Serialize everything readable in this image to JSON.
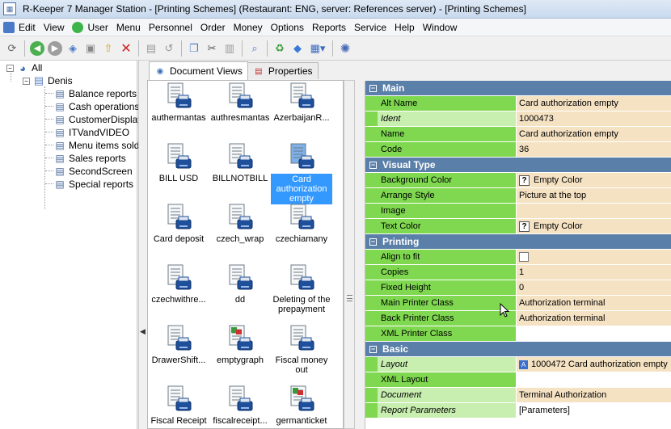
{
  "window": {
    "title": "R-Keeper 7 Manager Station - [Printing Schemes] (Restaurant: ENG, server: References server) - [Printing Schemes]"
  },
  "menu": [
    "Edit",
    "View",
    "User",
    "Menu",
    "Personnel",
    "Order",
    "Money",
    "Options",
    "Reports",
    "Service",
    "Help",
    "Window"
  ],
  "tree": {
    "root": "All",
    "child": "Denis",
    "items": [
      "Balance reports",
      "Cash operations",
      "CustomerDisplay",
      "ITVandVIDEO",
      "Menu items sold",
      "Sales reports",
      "SecondScreen",
      "Special reports"
    ]
  },
  "tabs": [
    "Document Views",
    "Properties"
  ],
  "documents": [
    "authermantas",
    "authresmantas",
    "AzerbaijanR...",
    "BILL USD",
    "BILLNOTBILL",
    "Card authorization empty",
    "Card deposit",
    "czech_wrap",
    "czechiamany",
    "czechwithre...",
    "dd",
    "Deleting of the prepayment",
    "DrawerShift...",
    "emptygraph",
    "Fiscal money out",
    "Fiscal Receipt",
    "fiscalreceipt...",
    "germanticket"
  ],
  "selected_document": "Card authorization empty",
  "properties": {
    "main": {
      "title": "Main",
      "rows": [
        {
          "name": "Alt Name",
          "value": "Card authorization empty"
        },
        {
          "name": "Ident",
          "value": "1000473"
        },
        {
          "name": "Name",
          "value": "Card authorization empty"
        },
        {
          "name": "Code",
          "value": "36"
        }
      ]
    },
    "visual": {
      "title": "Visual Type",
      "rows": [
        {
          "name": "Background Color",
          "value": "Empty Color"
        },
        {
          "name": "Arrange Style",
          "value": "Picture at the top"
        },
        {
          "name": "Image",
          "value": ""
        },
        {
          "name": "Text Color",
          "value": "Empty Color"
        }
      ]
    },
    "printing": {
      "title": "Printing",
      "rows": [
        {
          "name": "Align to fit",
          "value": ""
        },
        {
          "name": "Copies",
          "value": "1"
        },
        {
          "name": "Fixed Height",
          "value": "0"
        },
        {
          "name": "Main Printer Class",
          "value": "Authorization terminal"
        },
        {
          "name": "Back Printer Class",
          "value": "Authorization terminal"
        },
        {
          "name": "XML Printer Class",
          "value": ""
        }
      ]
    },
    "basic": {
      "title": "Basic",
      "rows": [
        {
          "name": "Layout",
          "value": "1000472 Card authorization empty"
        },
        {
          "name": "XML Layout",
          "value": ""
        },
        {
          "name": "Document",
          "value": "Terminal Authorization"
        },
        {
          "name": "Report Parameters",
          "value": "[Parameters]"
        }
      ]
    },
    "glyph_help": "?",
    "glyph_layout": "A"
  },
  "colors": {
    "category": "#5a7fa8",
    "name_cell": "#7fd850",
    "name_cell_readonly": "#c8efb0",
    "value_cell": "#f5e2c3",
    "selection": "#3399ff"
  }
}
